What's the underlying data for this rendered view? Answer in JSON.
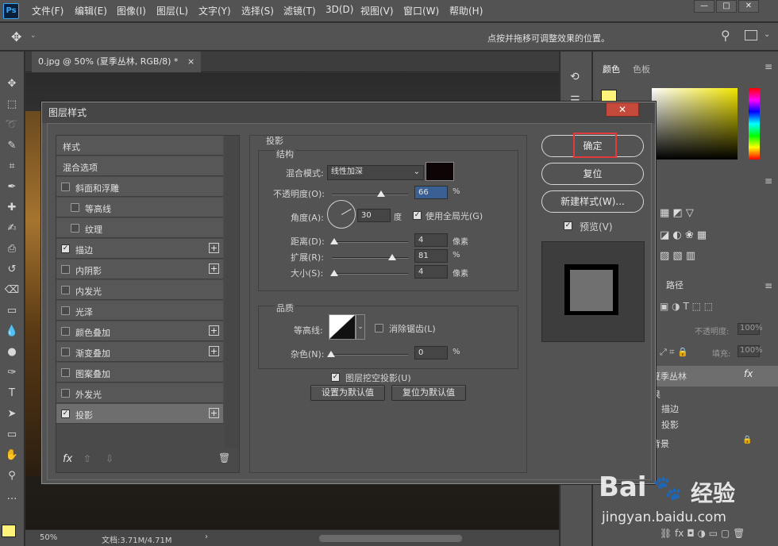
{
  "app": {
    "logo": "Ps",
    "menu": [
      "文件(F)",
      "编辑(E)",
      "图像(I)",
      "图层(L)",
      "文字(Y)",
      "选择(S)",
      "滤镜(T)",
      "3D(D)",
      "视图(V)",
      "窗口(W)",
      "帮助(H)"
    ],
    "window_controls": [
      "—",
      "□",
      "✕"
    ]
  },
  "options": {
    "hint": "点按并拖移可调整效果的位置。"
  },
  "document": {
    "tab_title": "0.jpg @ 50% (夏季丛林, RGB/8) *",
    "tab_close": "×",
    "zoom": "50%",
    "doc_size": "文档:3.71M/4.71M"
  },
  "right_panel": {
    "tabs": [
      "颜色",
      "色板"
    ],
    "paths_tab": "路径",
    "opacity_label": "不透明度:",
    "opacity_value": "100%",
    "fill_label": "填充:",
    "fill_value": "100%",
    "layers": [
      {
        "name": "夏季丛林",
        "fx": "fx"
      },
      {
        "name": "果"
      },
      {
        "name": "描边"
      },
      {
        "name": "投影"
      },
      {
        "name": "背景",
        "lock": "🔒"
      }
    ]
  },
  "dialog": {
    "title": "图层样式",
    "close": "✕",
    "styles_list": [
      {
        "label": "样式",
        "checkbox": null,
        "plus": false,
        "selected": false
      },
      {
        "label": "混合选项",
        "checkbox": null,
        "plus": false,
        "selected": false
      },
      {
        "label": "斜面和浮雕",
        "checkbox": false,
        "plus": false,
        "selected": false
      },
      {
        "label": "等高线",
        "checkbox": false,
        "plus": false,
        "selected": false,
        "indent": true
      },
      {
        "label": "纹理",
        "checkbox": false,
        "plus": false,
        "selected": false,
        "indent": true
      },
      {
        "label": "描边",
        "checkbox": true,
        "plus": true,
        "selected": false
      },
      {
        "label": "内阴影",
        "checkbox": false,
        "plus": true,
        "selected": false
      },
      {
        "label": "内发光",
        "checkbox": false,
        "plus": false,
        "selected": false
      },
      {
        "label": "光泽",
        "checkbox": false,
        "plus": false,
        "selected": false
      },
      {
        "label": "颜色叠加",
        "checkbox": false,
        "plus": true,
        "selected": false
      },
      {
        "label": "渐变叠加",
        "checkbox": false,
        "plus": true,
        "selected": false
      },
      {
        "label": "图案叠加",
        "checkbox": false,
        "plus": false,
        "selected": false
      },
      {
        "label": "外发光",
        "checkbox": false,
        "plus": false,
        "selected": false
      },
      {
        "label": "投影",
        "checkbox": true,
        "plus": true,
        "selected": true
      }
    ],
    "footer": {
      "fx": "fx",
      "up": "⇧",
      "down": "⇩",
      "trash": "🗑"
    },
    "section_title": "投影",
    "structure": {
      "title": "结构",
      "blend_mode_label": "混合模式:",
      "blend_mode_value": "线性加深",
      "blend_color": "#0d0505",
      "opacity_label": "不透明度(O):",
      "opacity_value": "66",
      "opacity_unit": "%",
      "opacity_fraction": 0.66,
      "angle_label": "角度(A):",
      "angle_value": "30",
      "angle_unit": "度",
      "global_light_label": "使用全局光(G)",
      "global_light_checked": true,
      "distance_label": "距离(D):",
      "distance_value": "4",
      "distance_unit": "像素",
      "spread_label": "扩展(R):",
      "spread_value": "81",
      "spread_unit": "%",
      "size_label": "大小(S):",
      "size_value": "4",
      "size_unit": "像素"
    },
    "quality": {
      "title": "品质",
      "contour_label": "等高线:",
      "antialias_label": "消除锯齿(L)",
      "antialias_checked": false,
      "noise_label": "杂色(N):",
      "noise_value": "0",
      "noise_unit": "%"
    },
    "knockout_label": "图层挖空投影(U)",
    "knockout_checked": true,
    "set_default": "设置为默认值",
    "reset_default": "复位为默认值",
    "ok": "确定",
    "reset": "复位",
    "new_style": "新建样式(W)...",
    "preview_label": "预览(V)",
    "preview_checked": true
  },
  "watermark": {
    "brand": "Bai",
    "brand_cn": "经验",
    "url": "jingyan.baidu.com"
  }
}
